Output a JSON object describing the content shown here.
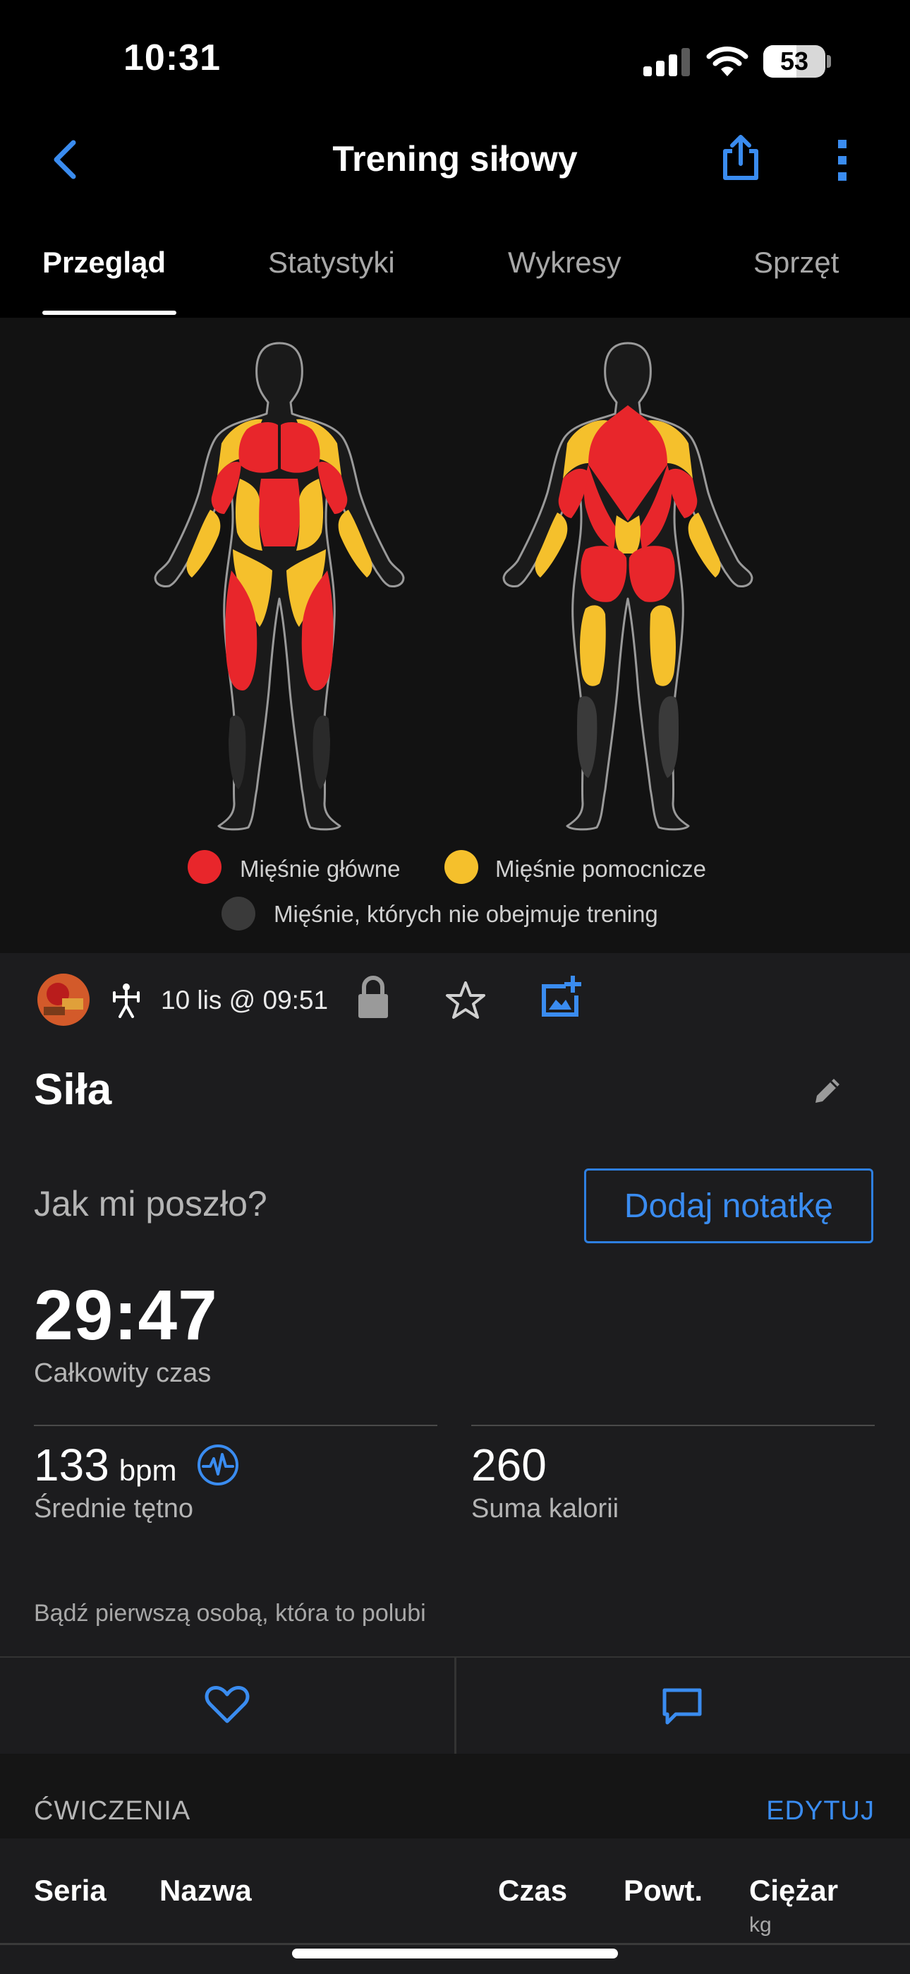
{
  "status": {
    "time": "10:31",
    "battery": "53",
    "battery_level": 0.53
  },
  "nav": {
    "title": "Trening siłowy",
    "back_icon": "chevron-left-icon",
    "share_icon": "share-icon",
    "more_icon": "more-vertical-icon"
  },
  "tabs": [
    {
      "label": "Przegląd",
      "active": true
    },
    {
      "label": "Statystyki",
      "active": false
    },
    {
      "label": "Wykresy",
      "active": false
    },
    {
      "label": "Sprzęt",
      "active": false
    }
  ],
  "legend": {
    "primary": "Mięśnie główne",
    "secondary": "Mięśnie pomocnicze",
    "untrained": "Mięśnie, których nie obejmuje trening"
  },
  "colors": {
    "accent": "#3a8cf0",
    "primary": "#e8262b",
    "secondary": "#f5c02c",
    "untrained": "#3a3a3a"
  },
  "activity": {
    "date": "10 lis @ 09:51",
    "title": "Siła",
    "question": "Jak mi poszło?",
    "add_note": "Dodaj notatkę"
  },
  "stats": {
    "total_time": "29:47",
    "total_time_label": "Całkowity czas",
    "avg_hr": "133",
    "avg_hr_unit": "bpm",
    "avg_hr_label": "Średnie tętno",
    "calories": "260",
    "calories_label": "Suma kalorii"
  },
  "social": {
    "like_prompt": "Bądź pierwszą osobą, która to polubi"
  },
  "exercises": {
    "title": "ĆWICZENIA",
    "edit": "EDYTUJ",
    "columns": {
      "set": "Seria",
      "name": "Nazwa",
      "time": "Czas",
      "reps": "Powt.",
      "weight": "Ciężar",
      "weight_unit": "kg"
    }
  }
}
